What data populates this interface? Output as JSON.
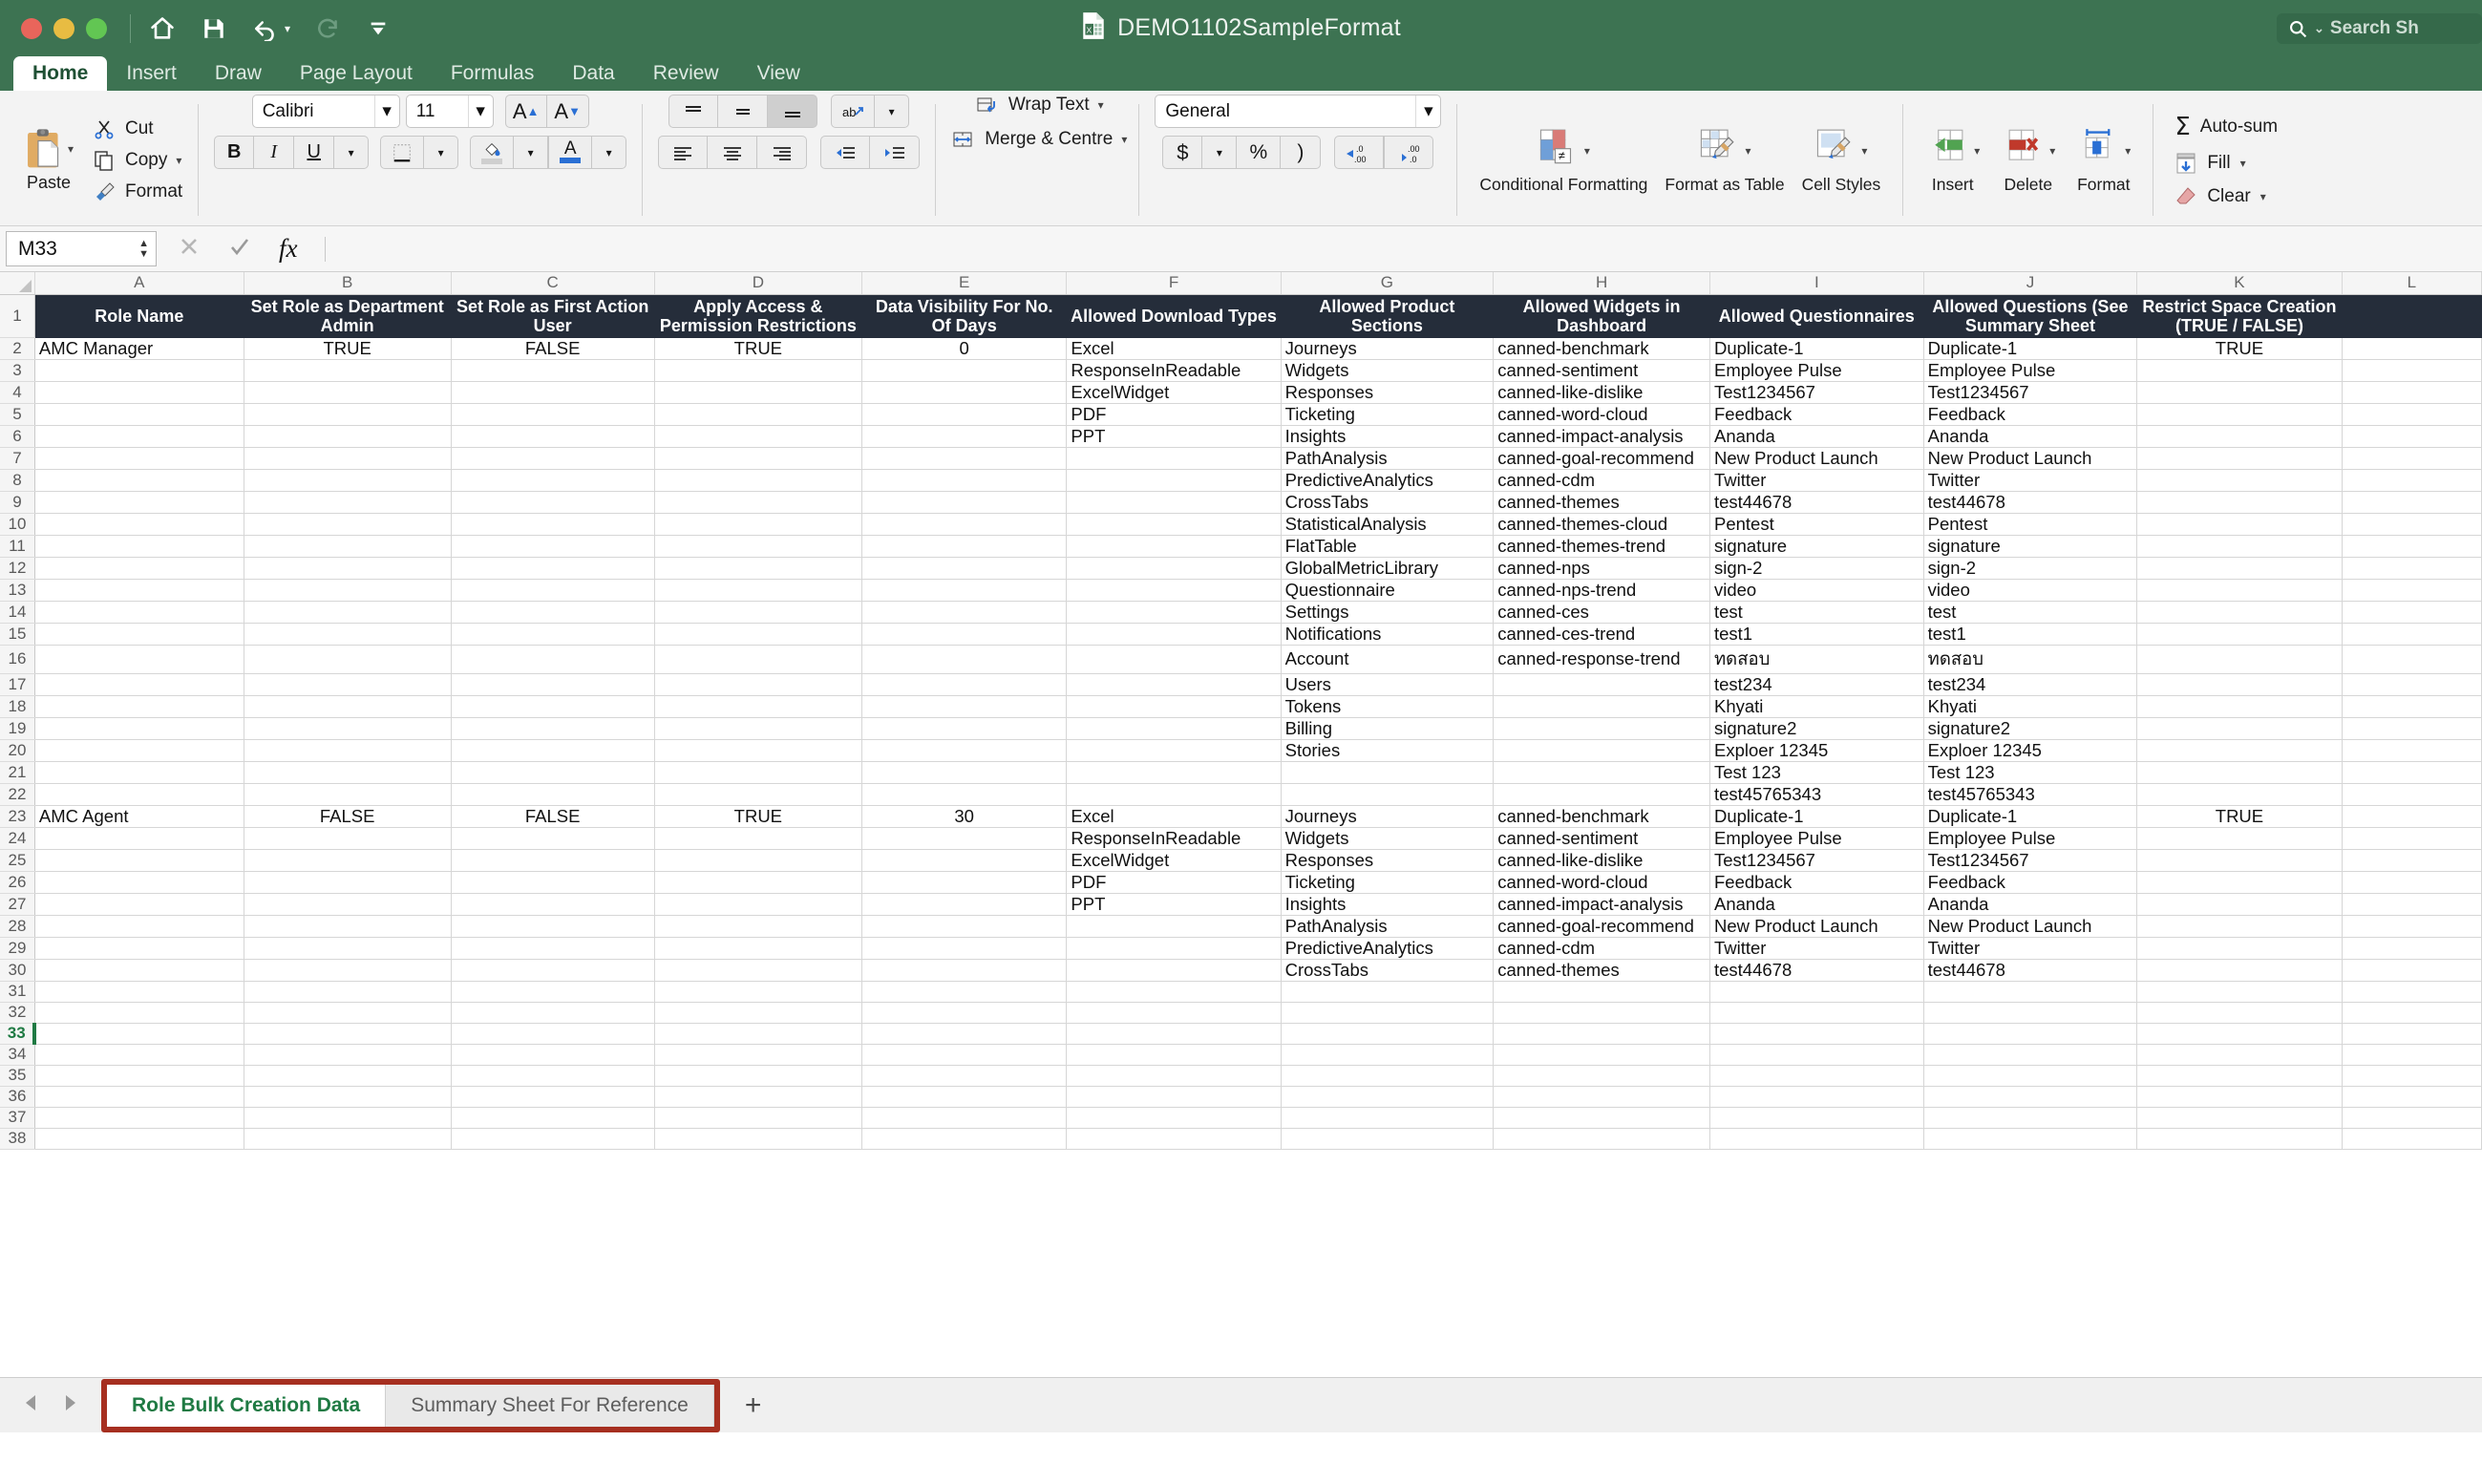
{
  "window": {
    "title": "DEMO1102SampleFormat",
    "search_placeholder": "Search Sh",
    "traffic_lights": [
      "close",
      "minimize",
      "zoom"
    ],
    "quick_access": [
      "home-icon",
      "save-icon",
      "undo-icon",
      "redo-icon",
      "customize-toolbar-icon"
    ],
    "accent_green": "#3d7352",
    "header_navy": "#252d3a",
    "highlight_red": "#a62f20"
  },
  "ribbon": {
    "tabs": [
      "Home",
      "Insert",
      "Draw",
      "Page Layout",
      "Formulas",
      "Data",
      "Review",
      "View"
    ],
    "active_tab": "Home",
    "clipboard": {
      "paste": "Paste",
      "cut": "Cut",
      "copy": "Copy",
      "format": "Format"
    },
    "font": {
      "family": "Calibri",
      "size": "11",
      "grow": "A",
      "shrink": "A",
      "bold": "B",
      "italic": "I",
      "underline": "U"
    },
    "alignment": {
      "wrap_text": "Wrap Text",
      "merge_centre": "Merge & Centre"
    },
    "number": {
      "format": "General",
      "currency": "$",
      "percent": "%",
      "comma": ")"
    },
    "styles": {
      "conditional": "Conditional Formatting",
      "table": "Format as Table",
      "cell": "Cell Styles"
    },
    "cells": {
      "insert": "Insert",
      "delete": "Delete",
      "format": "Format"
    },
    "editing": {
      "autosum": "Auto-sum",
      "fill": "Fill",
      "clear": "Clear"
    }
  },
  "formula_bar": {
    "name_box": "M33",
    "formula": "",
    "cancel": "cancel-icon",
    "enter": "enter-icon",
    "fx": "fx"
  },
  "sheet": {
    "columns": [
      "A",
      "B",
      "C",
      "D",
      "E",
      "F",
      "G",
      "H",
      "I",
      "J",
      "K",
      "L"
    ],
    "selected_cell": "M33",
    "selected_row": 33,
    "headers": [
      "Role Name",
      "Set Role as Department Admin",
      "Set Role as First Action User",
      "Apply Access & Permission Restrictions",
      "Data Visibility For No. Of Days",
      "Allowed Download Types",
      "Allowed Product Sections",
      "Allowed Widgets in Dashboard",
      "Allowed Questionnaires",
      "Allowed Questions (See Summary Sheet",
      "Restrict Space Creation (TRUE / FALSE)",
      ""
    ],
    "rows": [
      {
        "n": 2,
        "cells": [
          "AMC Manager",
          "TRUE",
          "FALSE",
          "TRUE",
          "0",
          "Excel",
          "Journeys",
          "canned-benchmark",
          "Duplicate-1",
          "Duplicate-1",
          "TRUE",
          ""
        ]
      },
      {
        "n": 3,
        "cells": [
          "",
          "",
          "",
          "",
          "",
          "ResponseInReadable",
          "Widgets",
          "canned-sentiment",
          "Employee Pulse",
          "Employee Pulse",
          "",
          ""
        ]
      },
      {
        "n": 4,
        "cells": [
          "",
          "",
          "",
          "",
          "",
          "ExcelWidget",
          "Responses",
          "canned-like-dislike",
          "Test1234567",
          "Test1234567",
          "",
          ""
        ]
      },
      {
        "n": 5,
        "cells": [
          "",
          "",
          "",
          "",
          "",
          "PDF",
          "Ticketing",
          "canned-word-cloud",
          "Feedback",
          "Feedback",
          "",
          ""
        ]
      },
      {
        "n": 6,
        "cells": [
          "",
          "",
          "",
          "",
          "",
          "PPT",
          "Insights",
          "canned-impact-analysis",
          "Ananda",
          "Ananda",
          "",
          ""
        ]
      },
      {
        "n": 7,
        "cells": [
          "",
          "",
          "",
          "",
          "",
          "",
          "PathAnalysis",
          "canned-goal-recommend",
          "New Product Launch",
          "New Product Launch",
          "",
          ""
        ]
      },
      {
        "n": 8,
        "cells": [
          "",
          "",
          "",
          "",
          "",
          "",
          "PredictiveAnalytics",
          "canned-cdm",
          "Twitter",
          "Twitter",
          "",
          ""
        ]
      },
      {
        "n": 9,
        "cells": [
          "",
          "",
          "",
          "",
          "",
          "",
          "CrossTabs",
          "canned-themes",
          "test44678",
          "test44678",
          "",
          ""
        ]
      },
      {
        "n": 10,
        "cells": [
          "",
          "",
          "",
          "",
          "",
          "",
          "StatisticalAnalysis",
          "canned-themes-cloud",
          "Pentest",
          "Pentest",
          "",
          ""
        ]
      },
      {
        "n": 11,
        "cells": [
          "",
          "",
          "",
          "",
          "",
          "",
          "FlatTable",
          "canned-themes-trend",
          "signature",
          "signature",
          "",
          ""
        ]
      },
      {
        "n": 12,
        "cells": [
          "",
          "",
          "",
          "",
          "",
          "",
          "GlobalMetricLibrary",
          "canned-nps",
          "sign-2",
          "sign-2",
          "",
          ""
        ]
      },
      {
        "n": 13,
        "cells": [
          "",
          "",
          "",
          "",
          "",
          "",
          "Questionnaire",
          "canned-nps-trend",
          "video",
          "video",
          "",
          ""
        ]
      },
      {
        "n": 14,
        "cells": [
          "",
          "",
          "",
          "",
          "",
          "",
          "Settings",
          "canned-ces",
          "test",
          "test",
          "",
          ""
        ]
      },
      {
        "n": 15,
        "cells": [
          "",
          "",
          "",
          "",
          "",
          "",
          "Notifications",
          "canned-ces-trend",
          "test1",
          "test1",
          "",
          ""
        ]
      },
      {
        "n": 16,
        "cells": [
          "",
          "",
          "",
          "",
          "",
          "",
          "Account",
          "canned-response-trend",
          "ทดสอบ",
          "ทดสอบ",
          "",
          ""
        ]
      },
      {
        "n": 17,
        "cells": [
          "",
          "",
          "",
          "",
          "",
          "",
          "Users",
          "",
          "test234",
          "test234",
          "",
          ""
        ]
      },
      {
        "n": 18,
        "cells": [
          "",
          "",
          "",
          "",
          "",
          "",
          "Tokens",
          "",
          "Khyati",
          "Khyati",
          "",
          ""
        ]
      },
      {
        "n": 19,
        "cells": [
          "",
          "",
          "",
          "",
          "",
          "",
          "Billing",
          "",
          "signature2",
          "signature2",
          "",
          ""
        ]
      },
      {
        "n": 20,
        "cells": [
          "",
          "",
          "",
          "",
          "",
          "",
          "Stories",
          "",
          "Exploer 12345",
          "Exploer 12345",
          "",
          ""
        ]
      },
      {
        "n": 21,
        "cells": [
          "",
          "",
          "",
          "",
          "",
          "",
          "",
          "",
          "Test 123",
          "Test 123",
          "",
          ""
        ]
      },
      {
        "n": 22,
        "cells": [
          "",
          "",
          "",
          "",
          "",
          "",
          "",
          "",
          "test45765343",
          "test45765343",
          "",
          ""
        ]
      },
      {
        "n": 23,
        "cells": [
          "AMC Agent",
          "FALSE",
          "FALSE",
          "TRUE",
          "30",
          "Excel",
          "Journeys",
          "canned-benchmark",
          "Duplicate-1",
          "Duplicate-1",
          "TRUE",
          ""
        ]
      },
      {
        "n": 24,
        "cells": [
          "",
          "",
          "",
          "",
          "",
          "ResponseInReadable",
          "Widgets",
          "canned-sentiment",
          "Employee Pulse",
          "Employee Pulse",
          "",
          ""
        ]
      },
      {
        "n": 25,
        "cells": [
          "",
          "",
          "",
          "",
          "",
          "ExcelWidget",
          "Responses",
          "canned-like-dislike",
          "Test1234567",
          "Test1234567",
          "",
          ""
        ]
      },
      {
        "n": 26,
        "cells": [
          "",
          "",
          "",
          "",
          "",
          "PDF",
          "Ticketing",
          "canned-word-cloud",
          "Feedback",
          "Feedback",
          "",
          ""
        ]
      },
      {
        "n": 27,
        "cells": [
          "",
          "",
          "",
          "",
          "",
          "PPT",
          "Insights",
          "canned-impact-analysis",
          "Ananda",
          "Ananda",
          "",
          ""
        ]
      },
      {
        "n": 28,
        "cells": [
          "",
          "",
          "",
          "",
          "",
          "",
          "PathAnalysis",
          "canned-goal-recommend",
          "New Product Launch",
          "New Product Launch",
          "",
          ""
        ]
      },
      {
        "n": 29,
        "cells": [
          "",
          "",
          "",
          "",
          "",
          "",
          "PredictiveAnalytics",
          "canned-cdm",
          "Twitter",
          "Twitter",
          "",
          ""
        ]
      },
      {
        "n": 30,
        "cells": [
          "",
          "",
          "",
          "",
          "",
          "",
          "CrossTabs",
          "canned-themes",
          "test44678",
          "test44678",
          "",
          ""
        ]
      },
      {
        "n": 31,
        "cells": [
          "",
          "",
          "",
          "",
          "",
          "",
          "",
          "",
          "",
          "",
          "",
          ""
        ]
      },
      {
        "n": 32,
        "cells": [
          "",
          "",
          "",
          "",
          "",
          "",
          "",
          "",
          "",
          "",
          "",
          ""
        ]
      },
      {
        "n": 33,
        "cells": [
          "",
          "",
          "",
          "",
          "",
          "",
          "",
          "",
          "",
          "",
          "",
          ""
        ]
      },
      {
        "n": 34,
        "cells": [
          "",
          "",
          "",
          "",
          "",
          "",
          "",
          "",
          "",
          "",
          "",
          ""
        ]
      },
      {
        "n": 35,
        "cells": [
          "",
          "",
          "",
          "",
          "",
          "",
          "",
          "",
          "",
          "",
          "",
          ""
        ]
      },
      {
        "n": 36,
        "cells": [
          "",
          "",
          "",
          "",
          "",
          "",
          "",
          "",
          "",
          "",
          "",
          ""
        ]
      },
      {
        "n": 37,
        "cells": [
          "",
          "",
          "",
          "",
          "",
          "",
          "",
          "",
          "",
          "",
          "",
          ""
        ]
      },
      {
        "n": 38,
        "cells": [
          "",
          "",
          "",
          "",
          "",
          "",
          "",
          "",
          "",
          "",
          "",
          ""
        ]
      }
    ]
  },
  "sheet_tabs": {
    "tabs": [
      "Role Bulk Creation Data",
      "Summary Sheet For Reference"
    ],
    "active": "Role Bulk Creation Data",
    "add_label": "+",
    "prev": "prev-sheet-icon",
    "next": "next-sheet-icon"
  }
}
